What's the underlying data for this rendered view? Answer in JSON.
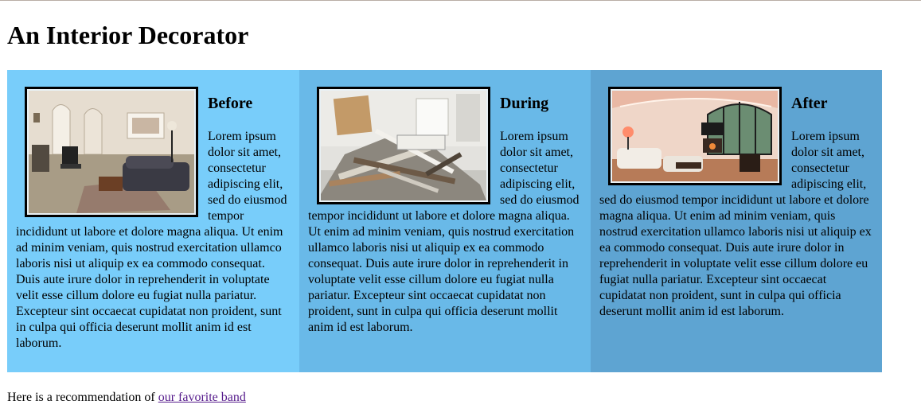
{
  "page": {
    "title": "An Interior Decorator",
    "panels": [
      {
        "heading": "Before",
        "image_alt": "messy living room",
        "body": "Lorem ipsum dolor sit amet, consectetur adipiscing elit, sed do eiusmod tempor incididunt ut labore et dolore magna aliqua. Ut enim ad minim veniam, quis nostrud exercitation ullamco laboris nisi ut aliquip ex ea commodo consequat. Duis aute irure dolor in reprehenderit in voluptate velit esse cillum dolore eu fugiat nulla pariatur. Excepteur sint occaecat cupidatat non proident, sunt in culpa qui officia deserunt mollit anim id est laborum."
      },
      {
        "heading": "During",
        "image_alt": "construction debris",
        "body": "Lorem ipsum dolor sit amet, consectetur adipiscing elit, sed do eiusmod tempor incididunt ut labore et dolore magna aliqua. Ut enim ad minim veniam, quis nostrud exercitation ullamco laboris nisi ut aliquip ex ea commodo consequat. Duis aute irure dolor in reprehenderit in voluptate velit esse cillum dolore eu fugiat nulla pariatur. Excepteur sint occaecat cupidatat non proident, sunt in culpa qui officia deserunt mollit anim id est laborum."
      },
      {
        "heading": "After",
        "image_alt": "finished living room",
        "body": "Lorem ipsum dolor sit amet, consectetur adipiscing elit, sed do eiusmod tempor incididunt ut labore et dolore magna aliqua. Ut enim ad minim veniam, quis nostrud exercitation ullamco laboris nisi ut aliquip ex ea commodo consequat. Duis aute irure dolor in reprehenderit in voluptate velit esse cillum dolore eu fugiat nulla pariatur. Excepteur sint occaecat cupidatat non proident, sunt in culpa qui officia deserunt mollit anim id est laborum."
      }
    ],
    "footer": {
      "text": "Here is a recommendation of ",
      "link_label": "our favorite band"
    }
  },
  "colors": {
    "panel_1": "#78cdfa",
    "panel_2": "#69b9e8",
    "panel_3": "#5ea4d2",
    "link": "#551a8b"
  }
}
